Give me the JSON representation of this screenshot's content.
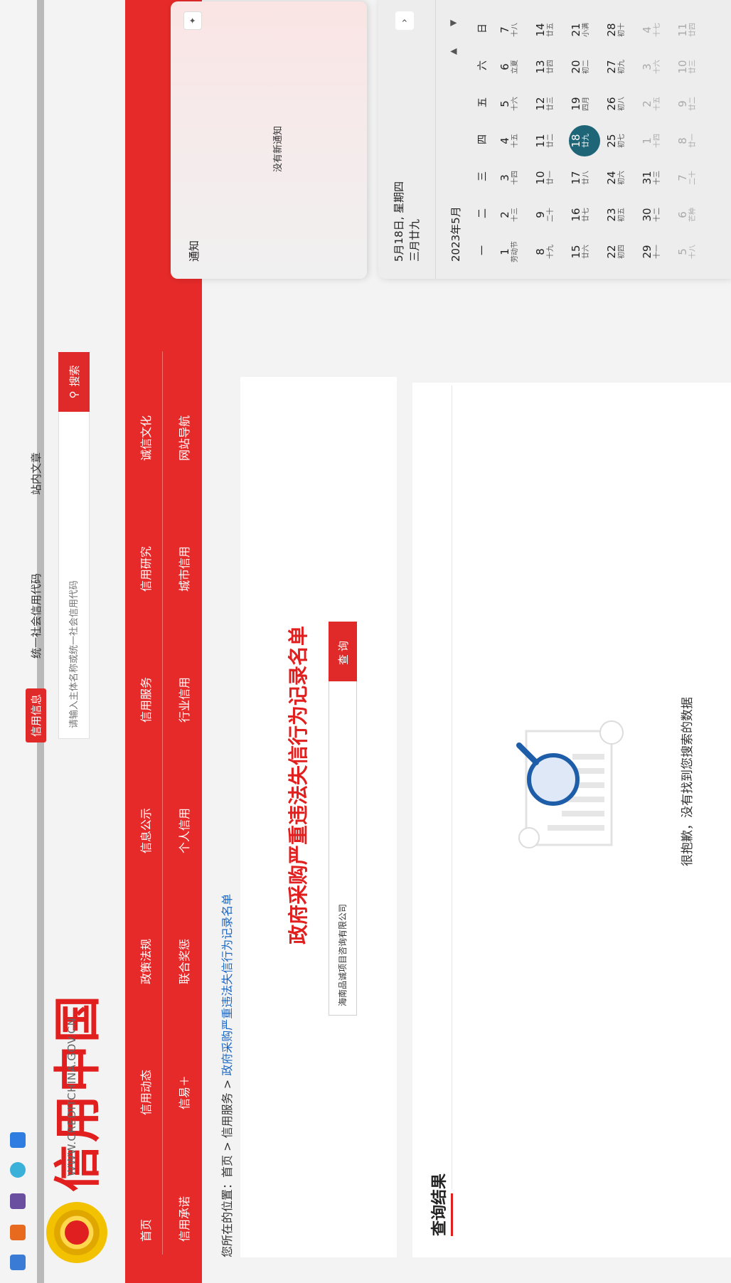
{
  "site": {
    "logo_text": "信用中国",
    "logo_sub": "WWW.CREDITCHINA.GOV.CN"
  },
  "search": {
    "tabs": [
      "信用信息",
      "统一社会信用代码",
      "站内文章"
    ],
    "placeholder": "请输入主体名称或统一社会信用代码",
    "button": "搜索"
  },
  "nav": {
    "row1": [
      "首页",
      "信用动态",
      "政策法规",
      "信息公示",
      "信用服务",
      "信用研究",
      "诚信文化"
    ],
    "row2": [
      "信用承诺",
      "信易＋",
      "联合奖惩",
      "个人信用",
      "行业信用",
      "城市信用",
      "网站导航"
    ]
  },
  "breadcrumb": {
    "prefix": "您所在的位置：",
    "home": "首页",
    "sep1": " > ",
    "service": "信用服务",
    "sep2": " > ",
    "current": "政府采购严重违法失信行为记录名单"
  },
  "query": {
    "title": "政府采购严重违法失信行为记录名单",
    "input_value": "海南品诚项目咨询有限公司",
    "button": "查询"
  },
  "results": {
    "title": "查询结果",
    "empty_text": "很抱歉，没有找到您搜索的数据"
  },
  "notification": {
    "title": "通知",
    "empty": "没有新通知"
  },
  "calendar": {
    "date_line1": "5月18日, 星期四",
    "date_line2": "三月廿九",
    "month": "2023年5月",
    "weekdays": [
      "一",
      "二",
      "三",
      "四",
      "五",
      "六",
      "日"
    ],
    "weeks": [
      [
        [
          "1",
          "劳动节"
        ],
        [
          "2",
          "十三"
        ],
        [
          "3",
          "十四"
        ],
        [
          "4",
          "十五"
        ],
        [
          "5",
          "十六"
        ],
        [
          "6",
          "立夏"
        ],
        [
          "7",
          "十八"
        ]
      ],
      [
        [
          "8",
          "十九"
        ],
        [
          "9",
          "二十"
        ],
        [
          "10",
          "廿一"
        ],
        [
          "11",
          "廿二"
        ],
        [
          "12",
          "廿三"
        ],
        [
          "13",
          "廿四"
        ],
        [
          "14",
          "廿五"
        ]
      ],
      [
        [
          "15",
          "廿六"
        ],
        [
          "16",
          "廿七"
        ],
        [
          "17",
          "廿八"
        ],
        [
          "18",
          "廿九"
        ],
        [
          "19",
          "四月"
        ],
        [
          "20",
          "初二"
        ],
        [
          "21",
          "小满"
        ]
      ],
      [
        [
          "22",
          "初四"
        ],
        [
          "23",
          "初五"
        ],
        [
          "24",
          "初六"
        ],
        [
          "25",
          "初七"
        ],
        [
          "26",
          "初八"
        ],
        [
          "27",
          "初九"
        ],
        [
          "28",
          "初十"
        ]
      ],
      [
        [
          "29",
          "十一"
        ],
        [
          "30",
          "十二"
        ],
        [
          "31",
          "十三"
        ],
        [
          "1",
          "十四"
        ],
        [
          "2",
          "十五"
        ],
        [
          "3",
          "十六"
        ],
        [
          "4",
          "十七"
        ]
      ],
      [
        [
          "5",
          "十八"
        ],
        [
          "6",
          "芒种"
        ],
        [
          "7",
          "二十"
        ],
        [
          "8",
          "廿一"
        ],
        [
          "9",
          "廿二"
        ],
        [
          "10",
          "廿三"
        ],
        [
          "11",
          "廿四"
        ]
      ]
    ],
    "today": [
      2,
      3
    ],
    "dim_from": [
      4,
      3
    ]
  },
  "colors": {
    "brand_red": "#e62a2a",
    "link_blue": "#1a67c6",
    "today_teal": "#1d6577"
  },
  "icons": [
    "search-icon",
    "chevron-right-icon",
    "caret-up-icon",
    "caret-down-icon",
    "notification-settings-icon",
    "magnifier-illustration"
  ]
}
